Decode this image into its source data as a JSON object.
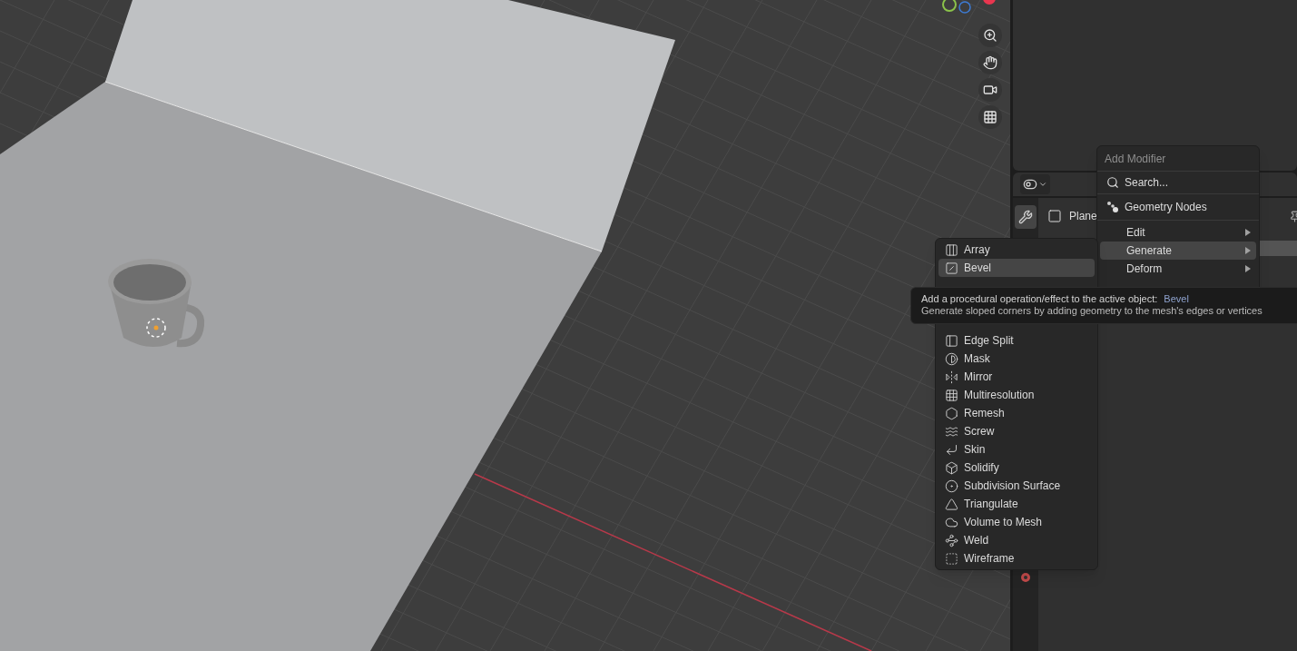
{
  "properties": {
    "object_name": "Plane",
    "tabs": [
      {
        "kind": "modifiers",
        "selected": true
      },
      {
        "kind": "constraints",
        "selected": false
      }
    ]
  },
  "add_modifier_menu": {
    "title": "Add Modifier",
    "items": [
      {
        "kind": "search",
        "label": "Search...",
        "selected": false
      },
      {
        "kind": "nodes",
        "label": "Geometry Nodes",
        "selected": false
      },
      {
        "kind": "submenu",
        "label": "Edit",
        "selected": false
      },
      {
        "kind": "submenu",
        "label": "Generate",
        "selected": true
      },
      {
        "kind": "submenu",
        "label": "Deform",
        "selected": false
      }
    ]
  },
  "generate_submenu": {
    "groups": [
      {
        "items": [
          {
            "label": "Array",
            "selected": false
          },
          {
            "label": "Bevel",
            "selected": true
          }
        ]
      },
      {
        "items": [
          {
            "label": "Edge Split",
            "selected": false
          },
          {
            "label": "Mask",
            "selected": false
          },
          {
            "label": "Mirror",
            "selected": false
          },
          {
            "label": "Multiresolution",
            "selected": false
          },
          {
            "label": "Remesh",
            "selected": false
          },
          {
            "label": "Screw",
            "selected": false
          },
          {
            "label": "Skin",
            "selected": false
          },
          {
            "label": "Solidify",
            "selected": false
          },
          {
            "label": "Subdivision Surface",
            "selected": false
          },
          {
            "label": "Triangulate",
            "selected": false
          },
          {
            "label": "Volume to Mesh",
            "selected": false
          },
          {
            "label": "Weld",
            "selected": false
          },
          {
            "label": "Wireframe",
            "selected": false
          }
        ]
      }
    ]
  },
  "tooltip": {
    "description": "Add a procedural operation/effect to the active object:",
    "name": "Bevel",
    "detail": "Generate sloped corners by adding geometry to the mesh's edges or vertices"
  }
}
